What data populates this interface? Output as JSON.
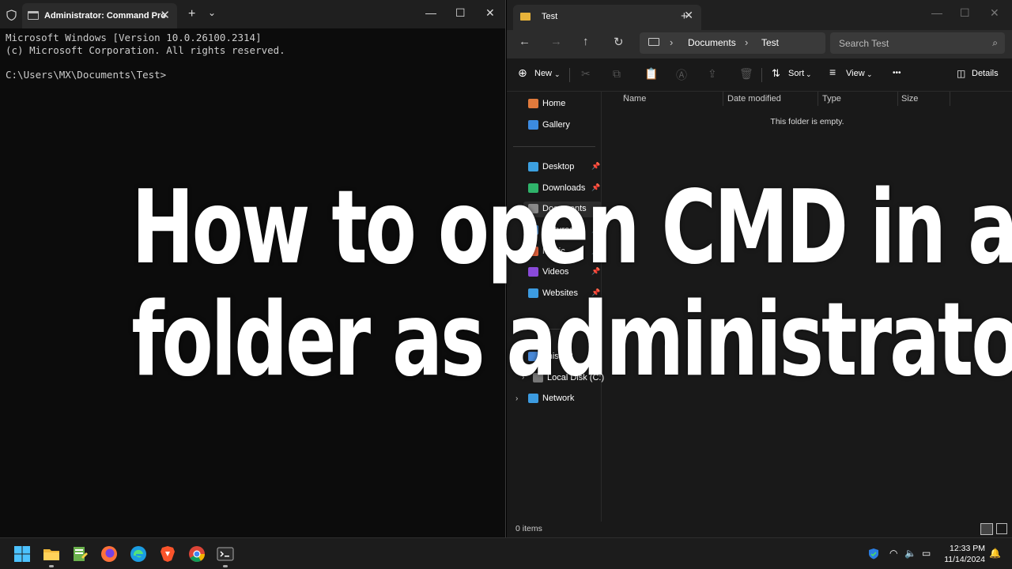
{
  "terminal": {
    "tab_title": "Administrator: Command Pro",
    "lines": [
      "Microsoft Windows [Version 10.0.26100.2314]",
      "(c) Microsoft Corporation. All rights reserved.",
      "",
      "C:\\Users\\MX\\Documents\\Test>"
    ],
    "new_tab": "+",
    "close": "✕",
    "menu": "⌄"
  },
  "explorer": {
    "tab_title": "Test",
    "breadcrumb": [
      "Documents",
      "Test"
    ],
    "search_placeholder": "Search Test",
    "commands": {
      "new": "New",
      "sort": "Sort",
      "view": "View",
      "more": "•••",
      "details": "Details"
    },
    "sidebar": {
      "top": [
        {
          "label": "Home",
          "icon": "home-icon",
          "color": "#e07a3c"
        },
        {
          "label": "Gallery",
          "icon": "gallery-icon",
          "color": "#3c8be0"
        }
      ],
      "pinned": [
        {
          "label": "Desktop",
          "icon": "desktop-icon",
          "color": "#3ca0e0"
        },
        {
          "label": "Downloads",
          "icon": "downloads-icon",
          "color": "#2fb36a"
        },
        {
          "label": "Documents",
          "icon": "documents-icon",
          "color": "#8a8a8a"
        },
        {
          "label": "Pictures",
          "icon": "pictures-icon",
          "color": "#4a90d9"
        },
        {
          "label": "Music",
          "icon": "music-icon",
          "color": "#e0603c"
        },
        {
          "label": "Videos",
          "icon": "videos-icon",
          "color": "#8a4ad9"
        },
        {
          "label": "Websites",
          "icon": "websites-icon",
          "color": "#3c9be0"
        }
      ],
      "this_pc": "This PC",
      "local_disk": "Local Disk (C:)",
      "network": "Network"
    },
    "columns": [
      "Name",
      "Date modified",
      "Type",
      "Size"
    ],
    "empty_message": "This folder is empty.",
    "status": "0 items"
  },
  "overlay": {
    "line1": "How to open CMD in a",
    "line2": "folder as administrator"
  },
  "taskbar": {
    "time": "12:33 PM",
    "date": "11/14/2024",
    "apps": [
      "start-icon",
      "file-explorer-icon",
      "notepad-icon",
      "firefox-icon",
      "edge-icon",
      "brave-icon",
      "chrome-icon",
      "terminal-icon"
    ]
  }
}
